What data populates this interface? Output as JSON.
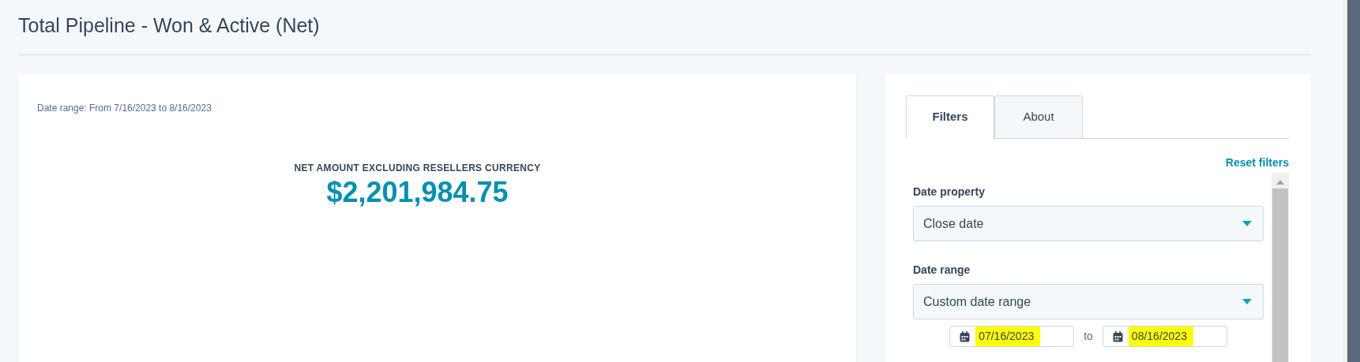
{
  "page": {
    "title": "Total Pipeline - Won & Active (Net)"
  },
  "report": {
    "date_range": "Date range: From 7/16/2023 to 8/16/2023",
    "metric_label": "NET AMOUNT EXCLUDING RESELLERS CURRENCY",
    "metric_value": "$2,201,984.75"
  },
  "tabs": [
    {
      "label": "Filters",
      "selected": true
    },
    {
      "label": "About",
      "selected": false
    }
  ],
  "reset_link": "Reset filters",
  "filters": [
    {
      "label": "Date property",
      "value": "Close date"
    },
    {
      "label": "Date range",
      "value": "Custom date range"
    }
  ],
  "custom_range": {
    "from": "07/16/2023",
    "separator": "to",
    "to": "08/16/2023",
    "highlighted": true
  }
}
